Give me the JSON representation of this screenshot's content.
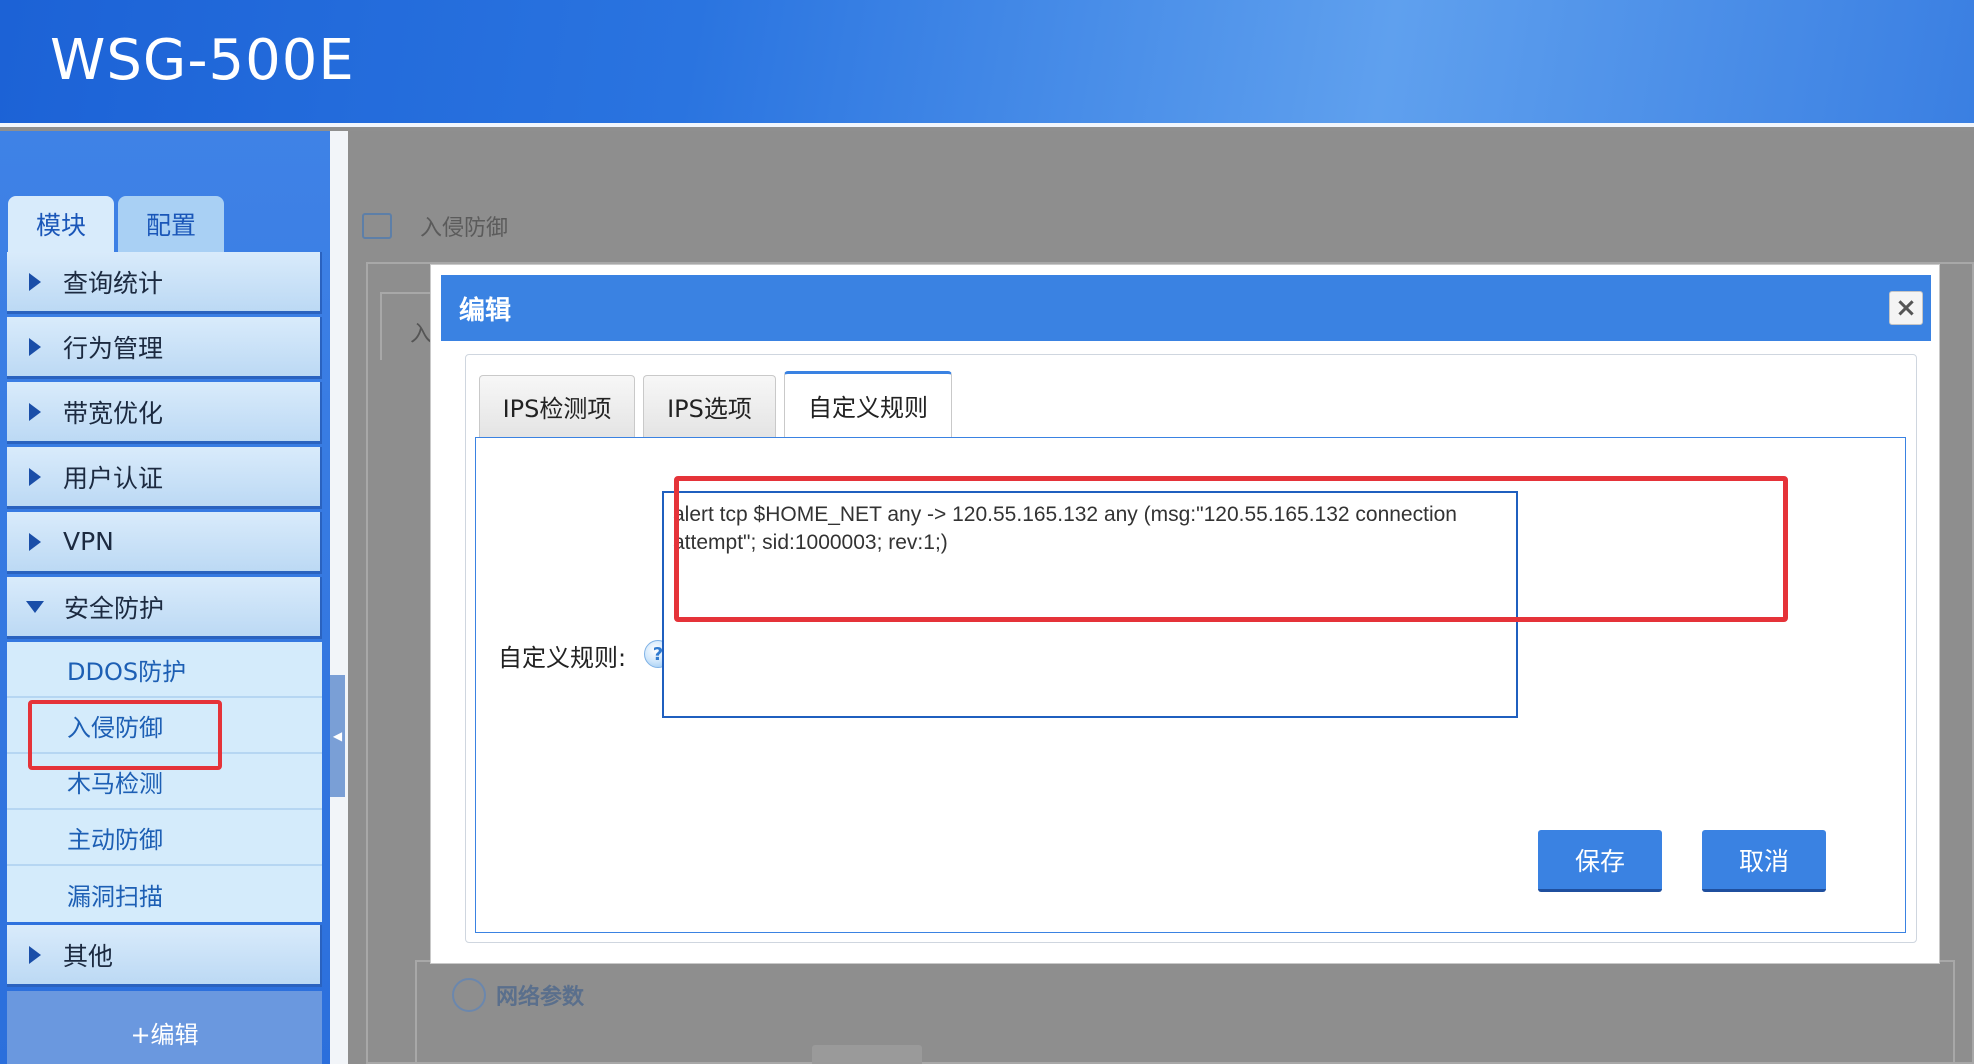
{
  "app": {
    "title": "WSG-500E"
  },
  "sidebar": {
    "tabs": [
      {
        "label": "模块",
        "active": true
      },
      {
        "label": "配置",
        "active": false
      }
    ],
    "items": [
      {
        "label": "查询统计",
        "expanded": false
      },
      {
        "label": "行为管理",
        "expanded": false
      },
      {
        "label": "带宽优化",
        "expanded": false
      },
      {
        "label": "用户认证",
        "expanded": false
      },
      {
        "label": "VPN",
        "expanded": false
      },
      {
        "label": "安全防护",
        "expanded": true
      },
      {
        "label": "其他",
        "expanded": false
      }
    ],
    "security_subitems": [
      {
        "label": "DDOS防护"
      },
      {
        "label": "入侵防御",
        "selected": true
      },
      {
        "label": "木马检测"
      },
      {
        "label": "主动防御"
      },
      {
        "label": "漏洞扫描"
      }
    ],
    "footer_label": "+编辑"
  },
  "background": {
    "breadcrumb": "入侵防御",
    "tab_fragment": "入",
    "section_title": "网络参数"
  },
  "modal": {
    "title": "编辑",
    "close_label": "×",
    "tabs": [
      {
        "label": "IPS检测项",
        "active": false
      },
      {
        "label": "IPS选项",
        "active": false
      },
      {
        "label": "自定义规则",
        "active": true
      }
    ],
    "field_label": "自定义规则:",
    "help_label": "?",
    "rule_value": "alert tcp $HOME_NET any -> 120.55.165.132 any (msg:\"120.55.165.132 connection attempt\"; sid:1000003; rev:1;)",
    "save_label": "保存",
    "cancel_label": "取消"
  },
  "colors": {
    "accent": "#3a82e2",
    "highlight": "#e53339",
    "sidebar_bg": "#2b6fdc"
  }
}
